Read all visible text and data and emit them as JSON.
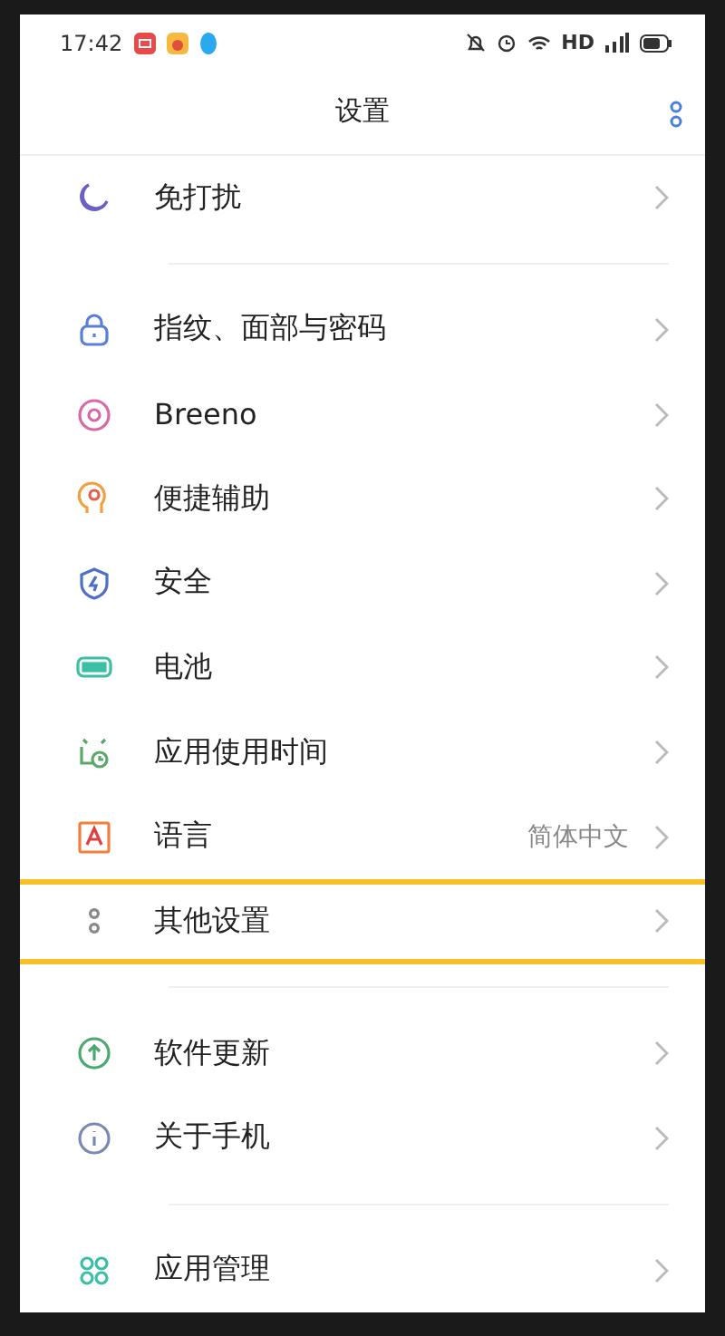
{
  "status_bar": {
    "time": "17:42",
    "network": "HD"
  },
  "header": {
    "title": "设置"
  },
  "groups": [
    {
      "rows": [
        {
          "label": "免打扰",
          "highlighted": false
        }
      ]
    },
    {
      "rows": [
        {
          "label": "指纹、面部与密码",
          "highlighted": false
        },
        {
          "label": "Breeno",
          "highlighted": false
        },
        {
          "label": "便捷辅助",
          "highlighted": false
        },
        {
          "label": "安全",
          "highlighted": false
        },
        {
          "label": "电池",
          "highlighted": false
        },
        {
          "label": "应用使用时间",
          "highlighted": false
        },
        {
          "label": "语言",
          "value": "简体中文",
          "highlighted": false
        },
        {
          "label": "其他设置",
          "highlighted": true
        }
      ]
    },
    {
      "rows": [
        {
          "label": "软件更新",
          "highlighted": false
        },
        {
          "label": "关于手机",
          "highlighted": false
        }
      ]
    },
    {
      "rows": [
        {
          "label": "应用管理",
          "highlighted": false
        }
      ]
    }
  ]
}
